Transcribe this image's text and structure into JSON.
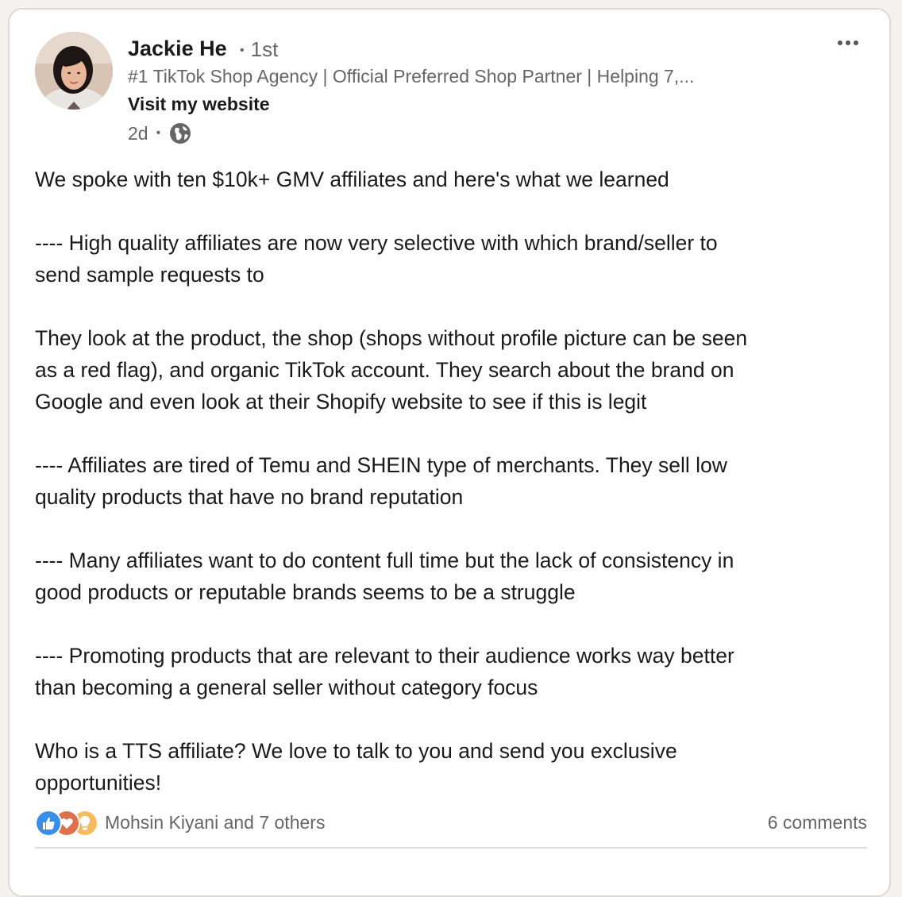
{
  "author": {
    "name": "Jackie He",
    "degree": "1st",
    "headline": "#1 TikTok Shop Agency | Official Preferred Shop Partner | Helping 7,...",
    "website_label": "Visit my website",
    "time_ago": "2d",
    "visibility_icon": "globe-icon"
  },
  "post": {
    "paragraphs": [
      "We spoke with ten $10k+ GMV affiliates and here's what we learned",
      "---- High quality affiliates are now very selective with which brand/seller to\nsend sample requests to",
      "They look at the product, the shop (shops without profile picture can be seen\nas a red flag), and organic TikTok account. They search about the brand on\nGoogle and even look at their Shopify website to see if this is legit",
      "---- Affiliates are tired of Temu and SHEIN type of merchants. They sell low\nquality products that have no brand reputation",
      "---- Many affiliates want to do content full time but the lack of consistency in\ngood products or reputable brands seems to be a struggle",
      "---- Promoting products that are relevant to their audience works way better\nthan becoming a general seller without category focus",
      "Who is a TTS affiliate? We love to talk to you and send you exclusive\nopportunities!"
    ]
  },
  "social": {
    "reaction_icons": [
      "like-icon",
      "love-icon",
      "insightful-icon"
    ],
    "reactions_text": "Mohsin Kiyani and 7 others",
    "comments_text": "6 comments"
  },
  "colors": {
    "like": "#378fe9",
    "love": "#df704d",
    "insightful": "#f5bb5c",
    "text_primary": "#1a1a1a",
    "text_secondary": "#666666"
  }
}
